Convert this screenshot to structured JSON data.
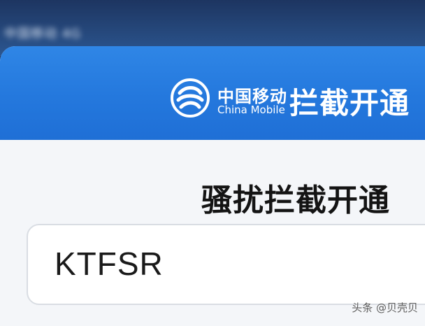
{
  "status_bar": {
    "blurred_text": "中国移动 4G"
  },
  "header": {
    "brand_cn": "中国移动",
    "brand_en": "China Mobile",
    "title": "拦截开通",
    "logo_icon": "china-mobile-logo-icon"
  },
  "main": {
    "page_title": "骚扰拦截开通",
    "code_input_value": "KTFSR"
  },
  "watermark": {
    "text": "头条 @贝壳贝"
  },
  "colors": {
    "header_blue": "#2478dd",
    "page_bg": "#f4f6f9",
    "title_text": "#141414"
  }
}
